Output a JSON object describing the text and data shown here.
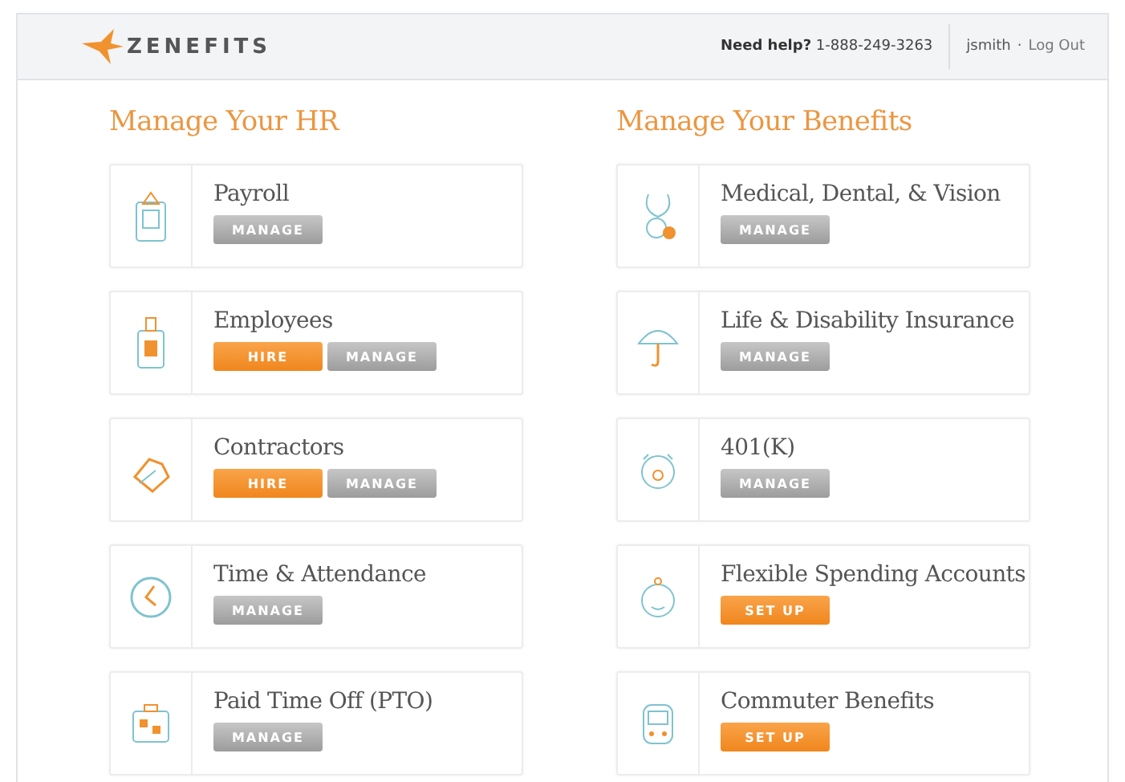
{
  "header": {
    "logo": "ZENEFITS",
    "help": "**Need help?** 1-888-249-3263",
    "user": "jsmith",
    "separator": "·",
    "logout": "Log Out"
  },
  "sections": [
    {
      "title": "Manage Your HR",
      "cards": [
        {
          "title": "Payroll",
          "buttons": [
            {
              "label": "MANAGE",
              "kind": "secondary"
            }
          ]
        },
        {
          "title": "Employees",
          "buttons": [
            {
              "label": "HIRE",
              "kind": "primary"
            },
            {
              "label": "MANAGE",
              "kind": "secondary"
            }
          ]
        },
        {
          "title": "Contractors",
          "buttons": [
            {
              "label": "HIRE",
              "kind": "primary"
            },
            {
              "label": "MANAGE",
              "kind": "secondary"
            }
          ]
        },
        {
          "title": "Time & Attendance",
          "buttons": [
            {
              "label": "MANAGE",
              "kind": "secondary"
            }
          ]
        },
        {
          "title": "Paid Time Off (PTO)",
          "buttons": [
            {
              "label": "MANAGE",
              "kind": "secondary"
            }
          ]
        }
      ]
    },
    {
      "title": "Manage Your Benefits",
      "cards": [
        {
          "title": "Medical, Dental, & Vision",
          "buttons": [
            {
              "label": "MANAGE",
              "kind": "secondary"
            }
          ]
        },
        {
          "title": "Life & Disability Insurance",
          "buttons": [
            {
              "label": "MANAGE",
              "kind": "secondary"
            }
          ]
        },
        {
          "title": "401(K)",
          "buttons": [
            {
              "label": "MANAGE",
              "kind": "secondary"
            }
          ]
        },
        {
          "title": "Flexible Spending Accounts",
          "buttons": [
            {
              "label": "SET UP",
              "kind": "primary"
            }
          ]
        },
        {
          "title": "Commuter Benefits",
          "buttons": [
            {
              "label": "SET UP",
              "kind": "primary"
            }
          ]
        }
      ]
    }
  ]
}
